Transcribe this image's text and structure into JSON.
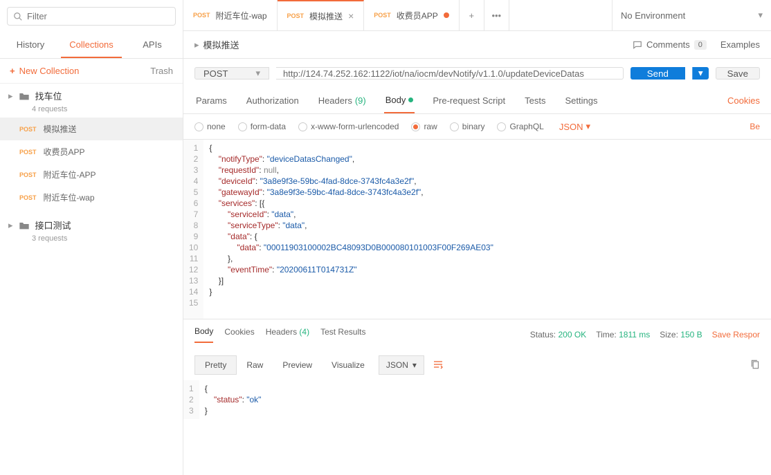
{
  "filter": {
    "placeholder": "Filter"
  },
  "sidebarTabs": [
    "History",
    "Collections",
    "APIs"
  ],
  "activeSidebarTab": 1,
  "sidebarActions": {
    "newCollection": "New Collection",
    "trash": "Trash"
  },
  "collections": [
    {
      "name": "找车位",
      "meta": "4 requests",
      "expanded": true,
      "items": [
        {
          "method": "POST",
          "name": "模拟推送",
          "active": true
        },
        {
          "method": "POST",
          "name": "收费员APP"
        },
        {
          "method": "POST",
          "name": "附近车位-APP"
        },
        {
          "method": "POST",
          "name": "附近车位-wap"
        }
      ]
    },
    {
      "name": "接口测试",
      "meta": "3 requests",
      "expanded": false
    }
  ],
  "tabs": [
    {
      "method": "POST",
      "name": "附近车位-wap",
      "active": false,
      "dirty": false
    },
    {
      "method": "POST",
      "name": "模拟推送",
      "active": true,
      "dirty": false
    },
    {
      "method": "POST",
      "name": "收费员APP",
      "active": false,
      "dirty": true
    }
  ],
  "env": {
    "label": "No Environment"
  },
  "breadcrumb": {
    "name": "模拟推送"
  },
  "topActions": {
    "comments": "Comments",
    "commentsCount": "0",
    "examples": "Examples"
  },
  "request": {
    "method": "POST",
    "url": "http://124.74.252.162:1122/iot/na/iocm/devNotify/v1.1.0/updateDeviceDatas",
    "send": "Send",
    "save": "Save"
  },
  "reqTabs": {
    "params": "Params",
    "auth": "Authorization",
    "headers": "Headers",
    "headersCount": "(9)",
    "body": "Body",
    "prereq": "Pre-request Script",
    "tests": "Tests",
    "settings": "Settings",
    "cookies": "Cookies"
  },
  "bodyTypes": {
    "none": "none",
    "formData": "form-data",
    "xwww": "x-www-form-urlencoded",
    "raw": "raw",
    "binary": "binary",
    "graphql": "GraphQL",
    "jsonSel": "JSON",
    "beautify": "Be"
  },
  "bodyCode": [
    "{",
    "    \"notifyType\": \"deviceDatasChanged\",",
    "    \"requestId\": null,",
    "    \"deviceId\": \"3a8e9f3e-59bc-4fad-8dce-3743fc4a3e2f\",",
    "    \"gatewayId\": \"3a8e9f3e-59bc-4fad-8dce-3743fc4a3e2f\",",
    "    \"services\": [{",
    "        \"serviceId\": \"data\",",
    "        \"serviceType\": \"data\",",
    "        \"data\": {",
    "            \"data\": \"00011903100002BC48093D0B000080101003F00F269AE03\"",
    "        },",
    "        \"eventTime\": \"20200611T014731Z\"",
    "    }]",
    "}",
    ""
  ],
  "response": {
    "tabs": {
      "body": "Body",
      "cookies": "Cookies",
      "headers": "Headers",
      "headersCount": "(4)",
      "testResults": "Test Results"
    },
    "status": {
      "label": "Status:",
      "value": "200 OK"
    },
    "time": {
      "label": "Time:",
      "value": "1811 ms"
    },
    "size": {
      "label": "Size:",
      "value": "150 B"
    },
    "save": "Save Respor",
    "toolbar": {
      "pretty": "Pretty",
      "raw": "Raw",
      "preview": "Preview",
      "visualize": "Visualize",
      "fmt": "JSON"
    },
    "code": [
      "{",
      "    \"status\": \"ok\"",
      "}"
    ]
  }
}
